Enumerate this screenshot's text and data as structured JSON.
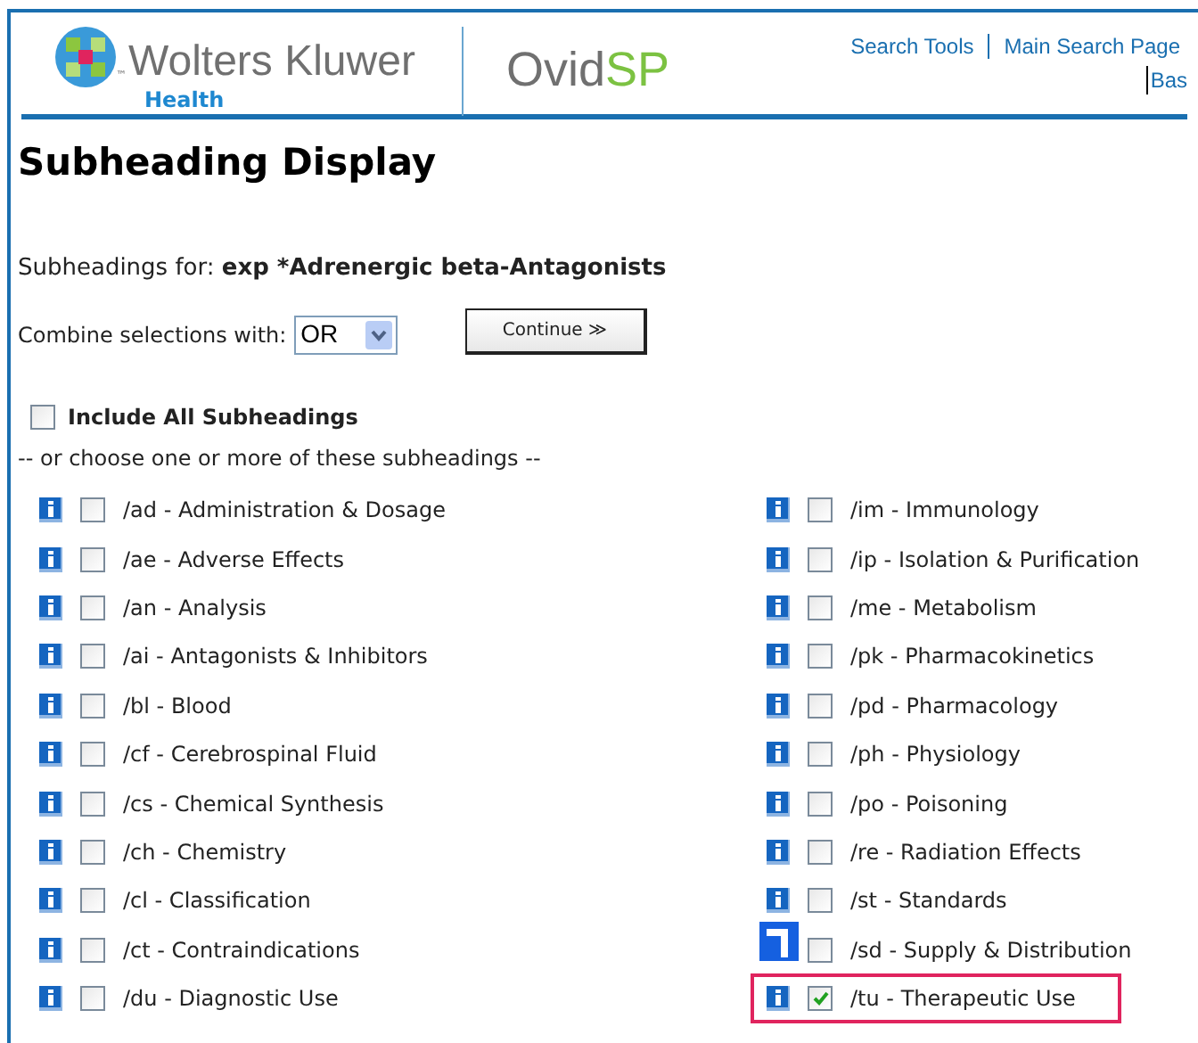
{
  "header": {
    "brand": {
      "tm": "™",
      "name": "Wolters Kluwer",
      "division": "Health"
    },
    "product": {
      "main": "Ovid",
      "accent": "SP"
    },
    "links": [
      "Search Tools",
      "Main Search Page"
    ],
    "link_cut": "Bas"
  },
  "title": "Subheading Display",
  "subject": "Subheadings for: **exp *Adrenergic beta-Antagonists**",
  "combine": {
    "label": "Combine selections with:",
    "value": "OR"
  },
  "continue_button": "Continue ≫",
  "include_all": {
    "label": "Include All Subheadings",
    "checked": false
  },
  "hint": "-- or choose one or more of these subheadings --",
  "columns": [
    [
      {
        "label": "/ad - Administration & Dosage",
        "checked": false,
        "highlighted": false,
        "info_pressed": false
      },
      {
        "label": "/ae - Adverse Effects",
        "checked": false,
        "highlighted": false,
        "info_pressed": false
      },
      {
        "label": "/an - Analysis",
        "checked": false,
        "highlighted": false,
        "info_pressed": false
      },
      {
        "label": "/ai - Antagonists & Inhibitors",
        "checked": false,
        "highlighted": false,
        "info_pressed": false
      },
      {
        "label": "/bl - Blood",
        "checked": false,
        "highlighted": false,
        "info_pressed": false
      },
      {
        "label": "/cf - Cerebrospinal Fluid",
        "checked": false,
        "highlighted": false,
        "info_pressed": false
      },
      {
        "label": "/cs - Chemical Synthesis",
        "checked": false,
        "highlighted": false,
        "info_pressed": false
      },
      {
        "label": "/ch - Chemistry",
        "checked": false,
        "highlighted": false,
        "info_pressed": false
      },
      {
        "label": "/cl - Classification",
        "checked": false,
        "highlighted": false,
        "info_pressed": false
      },
      {
        "label": "/ct - Contraindications",
        "checked": false,
        "highlighted": false,
        "info_pressed": false
      },
      {
        "label": "/du - Diagnostic Use",
        "checked": false,
        "highlighted": false,
        "info_pressed": false
      }
    ],
    [
      {
        "label": "/im - Immunology",
        "checked": false,
        "highlighted": false,
        "info_pressed": false
      },
      {
        "label": "/ip - Isolation & Purification",
        "checked": false,
        "highlighted": false,
        "info_pressed": false
      },
      {
        "label": "/me - Metabolism",
        "checked": false,
        "highlighted": false,
        "info_pressed": false
      },
      {
        "label": "/pk - Pharmacokinetics",
        "checked": false,
        "highlighted": false,
        "info_pressed": false
      },
      {
        "label": "/pd - Pharmacology",
        "checked": false,
        "highlighted": false,
        "info_pressed": false
      },
      {
        "label": "/ph - Physiology",
        "checked": false,
        "highlighted": false,
        "info_pressed": false
      },
      {
        "label": "/po - Poisoning",
        "checked": false,
        "highlighted": false,
        "info_pressed": false
      },
      {
        "label": "/re - Radiation Effects",
        "checked": false,
        "highlighted": false,
        "info_pressed": false
      },
      {
        "label": "/st - Standards",
        "checked": false,
        "highlighted": false,
        "info_pressed": false
      },
      {
        "label": "/sd - Supply & Distribution",
        "checked": false,
        "highlighted": false,
        "info_pressed": true
      },
      {
        "label": "/tu - Therapeutic Use",
        "checked": true,
        "highlighted": true,
        "info_pressed": false
      }
    ]
  ]
}
